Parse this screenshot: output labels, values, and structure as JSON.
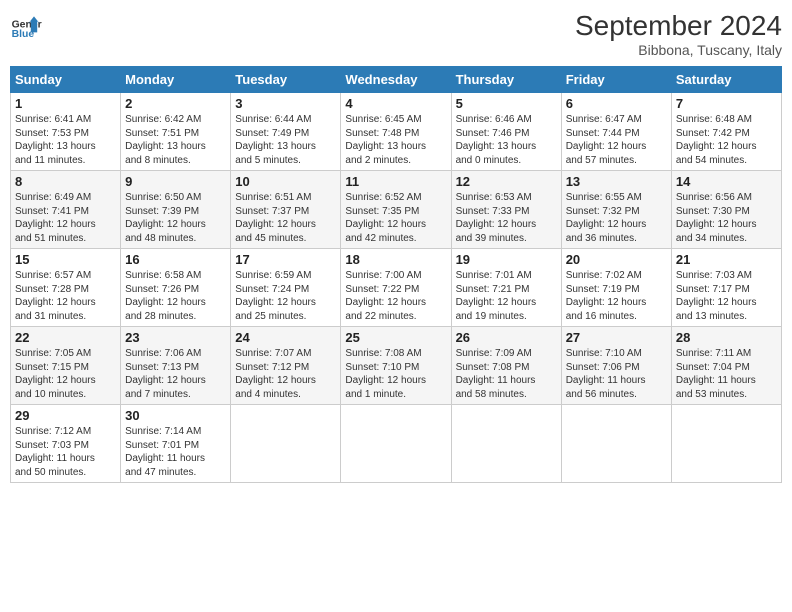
{
  "header": {
    "logo_line1": "General",
    "logo_line2": "Blue",
    "month": "September 2024",
    "location": "Bibbona, Tuscany, Italy"
  },
  "weekdays": [
    "Sunday",
    "Monday",
    "Tuesday",
    "Wednesday",
    "Thursday",
    "Friday",
    "Saturday"
  ],
  "weeks": [
    [
      {
        "day": "1",
        "info": "Sunrise: 6:41 AM\nSunset: 7:53 PM\nDaylight: 13 hours\nand 11 minutes."
      },
      {
        "day": "2",
        "info": "Sunrise: 6:42 AM\nSunset: 7:51 PM\nDaylight: 13 hours\nand 8 minutes."
      },
      {
        "day": "3",
        "info": "Sunrise: 6:44 AM\nSunset: 7:49 PM\nDaylight: 13 hours\nand 5 minutes."
      },
      {
        "day": "4",
        "info": "Sunrise: 6:45 AM\nSunset: 7:48 PM\nDaylight: 13 hours\nand 2 minutes."
      },
      {
        "day": "5",
        "info": "Sunrise: 6:46 AM\nSunset: 7:46 PM\nDaylight: 13 hours\nand 0 minutes."
      },
      {
        "day": "6",
        "info": "Sunrise: 6:47 AM\nSunset: 7:44 PM\nDaylight: 12 hours\nand 57 minutes."
      },
      {
        "day": "7",
        "info": "Sunrise: 6:48 AM\nSunset: 7:42 PM\nDaylight: 12 hours\nand 54 minutes."
      }
    ],
    [
      {
        "day": "8",
        "info": "Sunrise: 6:49 AM\nSunset: 7:41 PM\nDaylight: 12 hours\nand 51 minutes."
      },
      {
        "day": "9",
        "info": "Sunrise: 6:50 AM\nSunset: 7:39 PM\nDaylight: 12 hours\nand 48 minutes."
      },
      {
        "day": "10",
        "info": "Sunrise: 6:51 AM\nSunset: 7:37 PM\nDaylight: 12 hours\nand 45 minutes."
      },
      {
        "day": "11",
        "info": "Sunrise: 6:52 AM\nSunset: 7:35 PM\nDaylight: 12 hours\nand 42 minutes."
      },
      {
        "day": "12",
        "info": "Sunrise: 6:53 AM\nSunset: 7:33 PM\nDaylight: 12 hours\nand 39 minutes."
      },
      {
        "day": "13",
        "info": "Sunrise: 6:55 AM\nSunset: 7:32 PM\nDaylight: 12 hours\nand 36 minutes."
      },
      {
        "day": "14",
        "info": "Sunrise: 6:56 AM\nSunset: 7:30 PM\nDaylight: 12 hours\nand 34 minutes."
      }
    ],
    [
      {
        "day": "15",
        "info": "Sunrise: 6:57 AM\nSunset: 7:28 PM\nDaylight: 12 hours\nand 31 minutes."
      },
      {
        "day": "16",
        "info": "Sunrise: 6:58 AM\nSunset: 7:26 PM\nDaylight: 12 hours\nand 28 minutes."
      },
      {
        "day": "17",
        "info": "Sunrise: 6:59 AM\nSunset: 7:24 PM\nDaylight: 12 hours\nand 25 minutes."
      },
      {
        "day": "18",
        "info": "Sunrise: 7:00 AM\nSunset: 7:22 PM\nDaylight: 12 hours\nand 22 minutes."
      },
      {
        "day": "19",
        "info": "Sunrise: 7:01 AM\nSunset: 7:21 PM\nDaylight: 12 hours\nand 19 minutes."
      },
      {
        "day": "20",
        "info": "Sunrise: 7:02 AM\nSunset: 7:19 PM\nDaylight: 12 hours\nand 16 minutes."
      },
      {
        "day": "21",
        "info": "Sunrise: 7:03 AM\nSunset: 7:17 PM\nDaylight: 12 hours\nand 13 minutes."
      }
    ],
    [
      {
        "day": "22",
        "info": "Sunrise: 7:05 AM\nSunset: 7:15 PM\nDaylight: 12 hours\nand 10 minutes."
      },
      {
        "day": "23",
        "info": "Sunrise: 7:06 AM\nSunset: 7:13 PM\nDaylight: 12 hours\nand 7 minutes."
      },
      {
        "day": "24",
        "info": "Sunrise: 7:07 AM\nSunset: 7:12 PM\nDaylight: 12 hours\nand 4 minutes."
      },
      {
        "day": "25",
        "info": "Sunrise: 7:08 AM\nSunset: 7:10 PM\nDaylight: 12 hours\nand 1 minute."
      },
      {
        "day": "26",
        "info": "Sunrise: 7:09 AM\nSunset: 7:08 PM\nDaylight: 11 hours\nand 58 minutes."
      },
      {
        "day": "27",
        "info": "Sunrise: 7:10 AM\nSunset: 7:06 PM\nDaylight: 11 hours\nand 56 minutes."
      },
      {
        "day": "28",
        "info": "Sunrise: 7:11 AM\nSunset: 7:04 PM\nDaylight: 11 hours\nand 53 minutes."
      }
    ],
    [
      {
        "day": "29",
        "info": "Sunrise: 7:12 AM\nSunset: 7:03 PM\nDaylight: 11 hours\nand 50 minutes."
      },
      {
        "day": "30",
        "info": "Sunrise: 7:14 AM\nSunset: 7:01 PM\nDaylight: 11 hours\nand 47 minutes."
      },
      {
        "day": "",
        "info": ""
      },
      {
        "day": "",
        "info": ""
      },
      {
        "day": "",
        "info": ""
      },
      {
        "day": "",
        "info": ""
      },
      {
        "day": "",
        "info": ""
      }
    ]
  ]
}
